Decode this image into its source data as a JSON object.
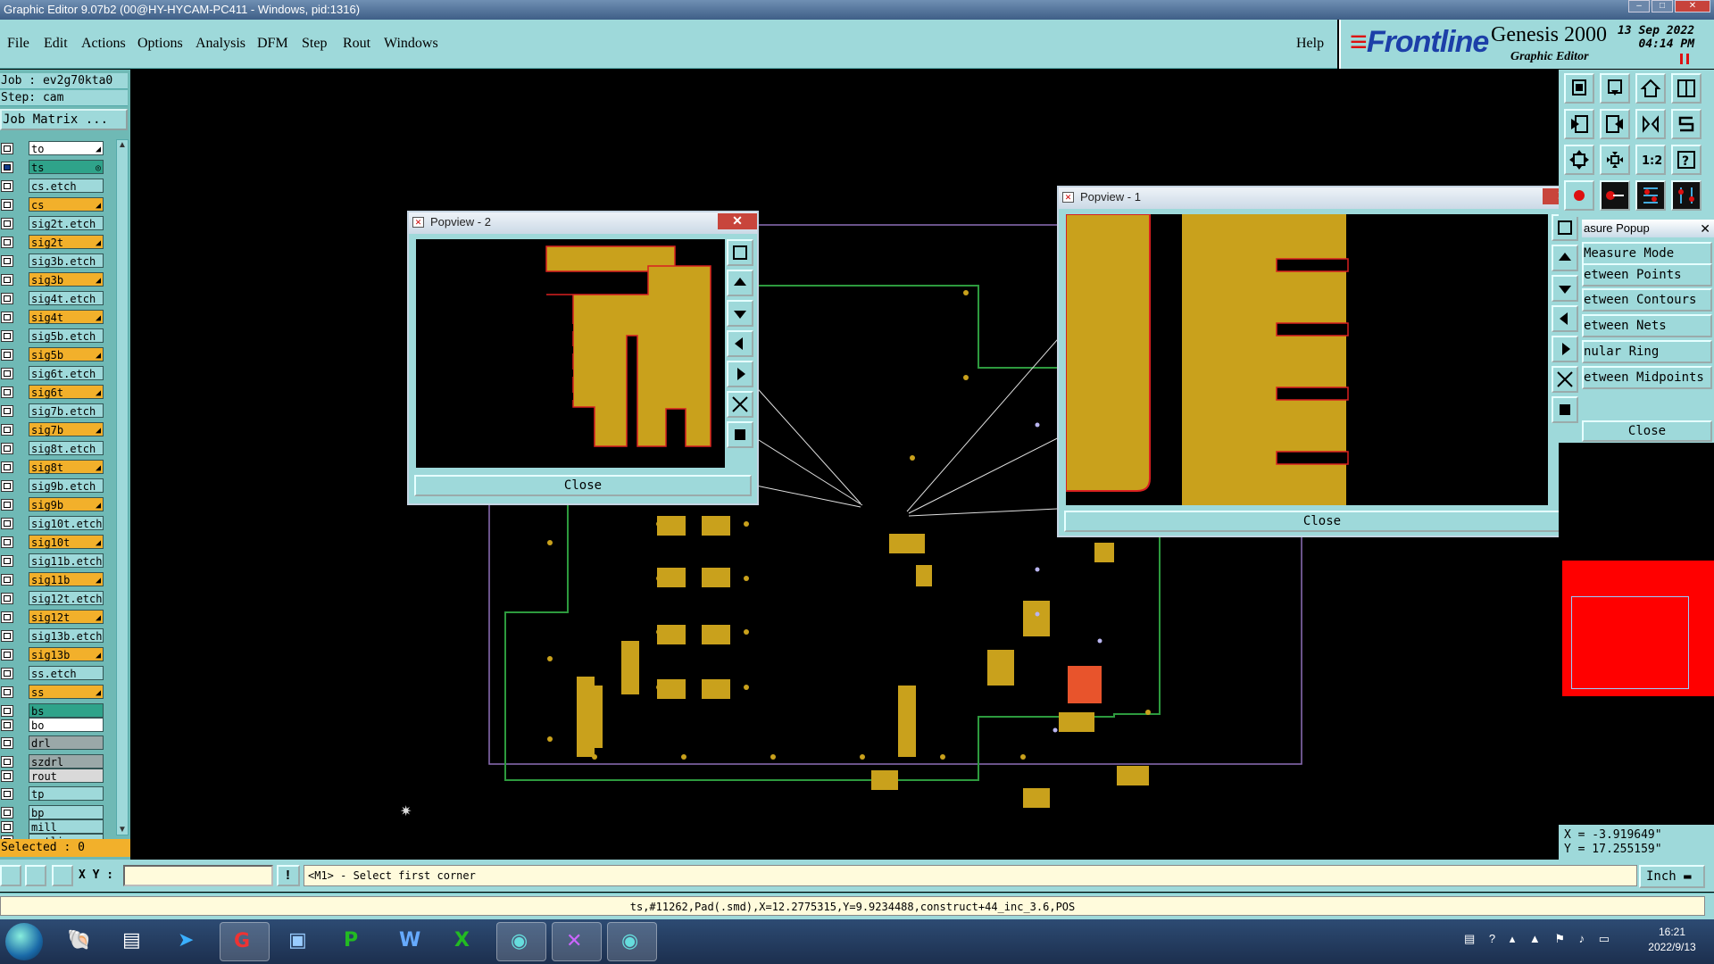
{
  "window": {
    "title": "Graphic Editor 9.07b2 (00@HY-HYCAM-PC411 - Windows, pid:1316)",
    "controls": [
      "minimize",
      "maximize",
      "close"
    ]
  },
  "menu": {
    "items": [
      "File",
      "Edit",
      "Actions",
      "Options",
      "Analysis",
      "DFM",
      "Step",
      "Rout",
      "Windows"
    ],
    "help": "Help"
  },
  "logo": {
    "brand": "Frontline",
    "product": "Genesis 2000",
    "subtitle": "Graphic Editor",
    "date": "13 Sep 2022",
    "time": "04:14 PM"
  },
  "job": {
    "job_label": "Job : ev2g70kta0",
    "step_label": "Step: cam",
    "matrix_button": "Job Matrix ..."
  },
  "layers": [
    {
      "name": "to",
      "color": "#ffffff",
      "mark": "◢",
      "checked": false
    },
    {
      "name": "ts",
      "color": "#2fa38a",
      "mark": "◎",
      "checked": true
    },
    {
      "name": "cs.etch",
      "color": "#9ed9da",
      "mark": "",
      "checked": false
    },
    {
      "name": "cs",
      "color": "#f2b02b",
      "mark": "◢",
      "checked": false
    },
    {
      "name": "sig2t.etch",
      "color": "#9ed9da",
      "mark": "",
      "checked": false
    },
    {
      "name": "sig2t",
      "color": "#f2b02b",
      "mark": "◢",
      "checked": false
    },
    {
      "name": "sig3b.etch",
      "color": "#9ed9da",
      "mark": "",
      "checked": false
    },
    {
      "name": "sig3b",
      "color": "#f2b02b",
      "mark": "◢",
      "checked": false
    },
    {
      "name": "sig4t.etch",
      "color": "#9ed9da",
      "mark": "",
      "checked": false
    },
    {
      "name": "sig4t",
      "color": "#f2b02b",
      "mark": "◢",
      "checked": false
    },
    {
      "name": "sig5b.etch",
      "color": "#9ed9da",
      "mark": "",
      "checked": false
    },
    {
      "name": "sig5b",
      "color": "#f2b02b",
      "mark": "◢",
      "checked": false
    },
    {
      "name": "sig6t.etch",
      "color": "#9ed9da",
      "mark": "",
      "checked": false
    },
    {
      "name": "sig6t",
      "color": "#f2b02b",
      "mark": "◢",
      "checked": false
    },
    {
      "name": "sig7b.etch",
      "color": "#9ed9da",
      "mark": "",
      "checked": false
    },
    {
      "name": "sig7b",
      "color": "#f2b02b",
      "mark": "◢",
      "checked": false
    },
    {
      "name": "sig8t.etch",
      "color": "#9ed9da",
      "mark": "",
      "checked": false
    },
    {
      "name": "sig8t",
      "color": "#f2b02b",
      "mark": "◢",
      "checked": false
    },
    {
      "name": "sig9b.etch",
      "color": "#9ed9da",
      "mark": "",
      "checked": false
    },
    {
      "name": "sig9b",
      "color": "#f2b02b",
      "mark": "◢",
      "checked": false
    },
    {
      "name": "sig10t.etch",
      "color": "#9ed9da",
      "mark": "",
      "checked": false
    },
    {
      "name": "sig10t",
      "color": "#f2b02b",
      "mark": "◢",
      "checked": false
    },
    {
      "name": "sig11b.etch",
      "color": "#9ed9da",
      "mark": "",
      "checked": false
    },
    {
      "name": "sig11b",
      "color": "#f2b02b",
      "mark": "◢",
      "checked": false
    },
    {
      "name": "sig12t.etch",
      "color": "#9ed9da",
      "mark": "",
      "checked": false
    },
    {
      "name": "sig12t",
      "color": "#f2b02b",
      "mark": "◢",
      "checked": false
    },
    {
      "name": "sig13b.etch",
      "color": "#9ed9da",
      "mark": "",
      "checked": false
    },
    {
      "name": "sig13b",
      "color": "#f2b02b",
      "mark": "◢",
      "checked": false
    },
    {
      "name": "ss.etch",
      "color": "#9ed9da",
      "mark": "",
      "checked": false
    },
    {
      "name": "ss",
      "color": "#f2b02b",
      "mark": "◢",
      "checked": false
    },
    {
      "name": "bs",
      "color": "#2fa38a",
      "mark": "",
      "checked": false
    },
    {
      "name": "bo",
      "color": "#ffffff",
      "mark": "",
      "checked": false
    },
    {
      "name": "drl",
      "color": "#9aa8a8",
      "mark": "",
      "checked": false
    },
    {
      "name": "szdrl",
      "color": "#9aa8a8",
      "mark": "",
      "checked": false
    },
    {
      "name": "rout",
      "color": "#d9d9d9",
      "mark": "",
      "checked": false
    },
    {
      "name": "tp",
      "color": "#9ed9da",
      "mark": "",
      "checked": false
    },
    {
      "name": "bp",
      "color": "#9ed9da",
      "mark": "",
      "checked": false
    },
    {
      "name": "mill",
      "color": "#9ed9da",
      "mark": "",
      "checked": false
    },
    {
      "name": "outline",
      "color": "#9ed9da",
      "mark": "",
      "checked": false
    }
  ],
  "selected_label": "Selected : 0",
  "popview1": {
    "title": "Popview - 1",
    "close": "Close"
  },
  "popview2": {
    "title": "Popview - 2",
    "close": "Close"
  },
  "measure": {
    "title": "asure Popup",
    "items": [
      "Measure Mode",
      "etween Points",
      "etween Contours",
      "etween Nets",
      "nular Ring",
      "etween Midpoints"
    ],
    "close": "Close"
  },
  "coords": {
    "x": "X = -3.919649\"",
    "y": "Y = 17.255159\""
  },
  "command": {
    "xy_label": "X Y :",
    "xy_value": "",
    "prompt": "<M1> - Select first corner",
    "units": "Inch"
  },
  "status_line": "ts,#11262,Pad(.smd),X=12.2775315,Y=9.9234488,construct+44_inc_3.6,POS",
  "taskbar": {
    "apps": [
      "shell-app",
      "notepad",
      "arrow-app",
      "red-g-app",
      "save-app",
      "green-p-app",
      "word",
      "excel",
      "eye-app",
      "genesis-x",
      "eye-app-2"
    ],
    "time": "16:21",
    "date": "2022/9/13"
  },
  "colors": {
    "panel": "#9ed9da",
    "copper": "#c9a11c",
    "accent_red": "#ff0000",
    "layer_orange": "#f2b02b"
  }
}
